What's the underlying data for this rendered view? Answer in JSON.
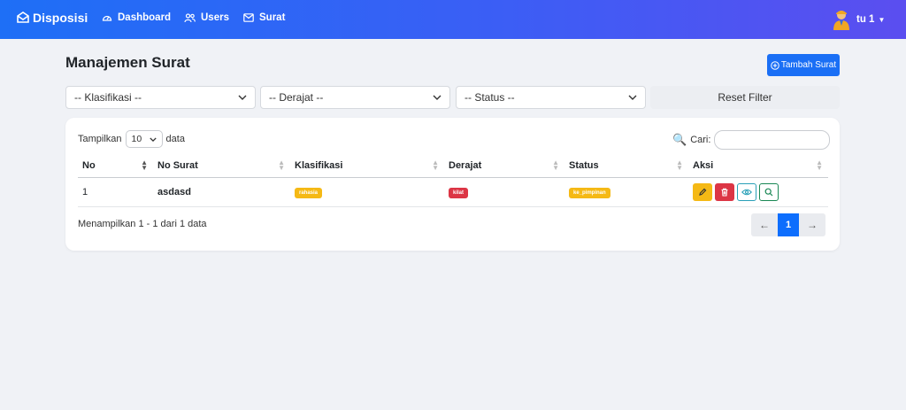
{
  "navbar": {
    "brand": "Disposisi",
    "items": [
      {
        "label": "Dashboard",
        "icon": "dashboard-icon"
      },
      {
        "label": "Users",
        "icon": "users-icon"
      },
      {
        "label": "Surat",
        "icon": "envelope-icon"
      }
    ],
    "user": "tu 1"
  },
  "header": {
    "title": "Manajemen Surat",
    "add_button": "Tambah Surat"
  },
  "filters": {
    "klasifikasi": "-- Klasifikasi --",
    "derajat": "-- Derajat --",
    "status": "-- Status --",
    "reset": "Reset Filter"
  },
  "table_controls": {
    "show_label": "Tampilkan",
    "page_length": "10",
    "data_label": "data",
    "search_label": "Cari:"
  },
  "table": {
    "columns": [
      "No",
      "No Surat",
      "Klasifikasi",
      "Derajat",
      "Status",
      "Aksi"
    ],
    "rows": [
      {
        "no": "1",
        "no_surat": "asdasd",
        "klasifikasi": "rahasia",
        "derajat": "kilat",
        "status": "ke_pimpinan"
      }
    ]
  },
  "footer": {
    "info": "Menampilkan 1 - 1 dari 1 data",
    "prev": "←",
    "page": "1",
    "next": "→"
  },
  "colors": {
    "navbar_start": "#1e6ff6",
    "navbar_end": "#5b4ef0",
    "primary": "#1a6ff5",
    "warning": "#f5b915",
    "danger": "#dc3545"
  }
}
